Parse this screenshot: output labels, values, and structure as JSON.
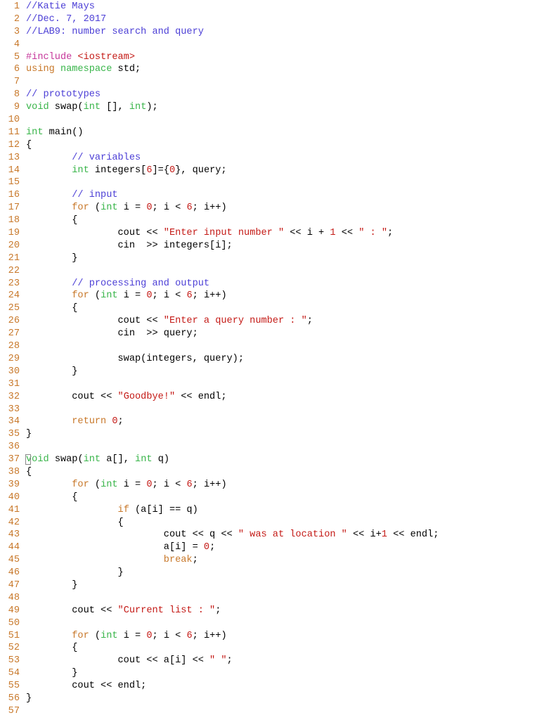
{
  "editor": {
    "colors": {
      "line_number": "#c8782a",
      "comment": "#4c3fd6",
      "preprocessor": "#c6389b",
      "include_path": "#c41a16",
      "keyword": "#c8782a",
      "type": "#39b54a",
      "number": "#c41a16",
      "string": "#c41a16",
      "plain": "#000000"
    },
    "cursor": {
      "line": 37,
      "column": 1
    },
    "lines": [
      {
        "n": "1",
        "tokens": [
          [
            "comment",
            "//Katie Mays"
          ]
        ]
      },
      {
        "n": "2",
        "tokens": [
          [
            "comment",
            "//Dec. 7, 2017"
          ]
        ]
      },
      {
        "n": "3",
        "tokens": [
          [
            "comment",
            "//LAB9: number search and query"
          ]
        ]
      },
      {
        "n": "4",
        "tokens": []
      },
      {
        "n": "5",
        "tokens": [
          [
            "preproc",
            "#include "
          ],
          [
            "include",
            "<iostream>"
          ]
        ]
      },
      {
        "n": "6",
        "tokens": [
          [
            "keyword",
            "using "
          ],
          [
            "type",
            "namespace "
          ],
          [
            "plain",
            "std;"
          ]
        ]
      },
      {
        "n": "7",
        "tokens": []
      },
      {
        "n": "8",
        "tokens": [
          [
            "comment",
            "// prototypes"
          ]
        ]
      },
      {
        "n": "9",
        "tokens": [
          [
            "type",
            "void "
          ],
          [
            "plain",
            "swap("
          ],
          [
            "type",
            "int "
          ],
          [
            "plain",
            "[], "
          ],
          [
            "type",
            "int"
          ],
          [
            "plain",
            ");"
          ]
        ]
      },
      {
        "n": "10",
        "tokens": []
      },
      {
        "n": "11",
        "tokens": [
          [
            "type",
            "int "
          ],
          [
            "plain",
            "main()"
          ]
        ]
      },
      {
        "n": "12",
        "tokens": [
          [
            "plain",
            "{"
          ]
        ]
      },
      {
        "n": "13",
        "tokens": [
          [
            "plain",
            "        "
          ],
          [
            "comment",
            "// variables"
          ]
        ]
      },
      {
        "n": "14",
        "tokens": [
          [
            "plain",
            "        "
          ],
          [
            "type",
            "int "
          ],
          [
            "plain",
            "integers["
          ],
          [
            "number",
            "6"
          ],
          [
            "plain",
            "]={"
          ],
          [
            "number",
            "0"
          ],
          [
            "plain",
            "}, query;"
          ]
        ]
      },
      {
        "n": "15",
        "tokens": []
      },
      {
        "n": "16",
        "tokens": [
          [
            "plain",
            "        "
          ],
          [
            "comment",
            "// input"
          ]
        ]
      },
      {
        "n": "17",
        "tokens": [
          [
            "plain",
            "        "
          ],
          [
            "keyword",
            "for "
          ],
          [
            "plain",
            "("
          ],
          [
            "type",
            "int "
          ],
          [
            "plain",
            "i = "
          ],
          [
            "number",
            "0"
          ],
          [
            "plain",
            "; i < "
          ],
          [
            "number",
            "6"
          ],
          [
            "plain",
            "; i++)"
          ]
        ]
      },
      {
        "n": "18",
        "tokens": [
          [
            "plain",
            "        {"
          ]
        ]
      },
      {
        "n": "19",
        "tokens": [
          [
            "plain",
            "                cout << "
          ],
          [
            "string",
            "\"Enter input number \""
          ],
          [
            "plain",
            " << i + "
          ],
          [
            "number",
            "1"
          ],
          [
            "plain",
            " << "
          ],
          [
            "string",
            "\" : \""
          ],
          [
            "plain",
            ";"
          ]
        ]
      },
      {
        "n": "20",
        "tokens": [
          [
            "plain",
            "                cin  >> integers[i];"
          ]
        ]
      },
      {
        "n": "21",
        "tokens": [
          [
            "plain",
            "        }"
          ]
        ]
      },
      {
        "n": "22",
        "tokens": []
      },
      {
        "n": "23",
        "tokens": [
          [
            "plain",
            "        "
          ],
          [
            "comment",
            "// processing and output"
          ]
        ]
      },
      {
        "n": "24",
        "tokens": [
          [
            "plain",
            "        "
          ],
          [
            "keyword",
            "for "
          ],
          [
            "plain",
            "("
          ],
          [
            "type",
            "int "
          ],
          [
            "plain",
            "i = "
          ],
          [
            "number",
            "0"
          ],
          [
            "plain",
            "; i < "
          ],
          [
            "number",
            "6"
          ],
          [
            "plain",
            "; i++)"
          ]
        ]
      },
      {
        "n": "25",
        "tokens": [
          [
            "plain",
            "        {"
          ]
        ]
      },
      {
        "n": "26",
        "tokens": [
          [
            "plain",
            "                cout << "
          ],
          [
            "string",
            "\"Enter a query number : \""
          ],
          [
            "plain",
            ";"
          ]
        ]
      },
      {
        "n": "27",
        "tokens": [
          [
            "plain",
            "                cin  >> query;"
          ]
        ]
      },
      {
        "n": "28",
        "tokens": []
      },
      {
        "n": "29",
        "tokens": [
          [
            "plain",
            "                swap(integers, query);"
          ]
        ]
      },
      {
        "n": "30",
        "tokens": [
          [
            "plain",
            "        }"
          ]
        ]
      },
      {
        "n": "31",
        "tokens": []
      },
      {
        "n": "32",
        "tokens": [
          [
            "plain",
            "        cout << "
          ],
          [
            "string",
            "\"Goodbye!\""
          ],
          [
            "plain",
            " << endl;"
          ]
        ]
      },
      {
        "n": "33",
        "tokens": []
      },
      {
        "n": "34",
        "tokens": [
          [
            "plain",
            "        "
          ],
          [
            "keyword",
            "return "
          ],
          [
            "number",
            "0"
          ],
          [
            "plain",
            ";"
          ]
        ]
      },
      {
        "n": "35",
        "tokens": [
          [
            "plain",
            "}"
          ]
        ]
      },
      {
        "n": "36",
        "tokens": []
      },
      {
        "n": "37",
        "tokens": [
          [
            "cursor",
            "v"
          ],
          [
            "type",
            "oid "
          ],
          [
            "plain",
            "swap("
          ],
          [
            "type",
            "int "
          ],
          [
            "plain",
            "a[], "
          ],
          [
            "type",
            "int "
          ],
          [
            "plain",
            "q)"
          ]
        ]
      },
      {
        "n": "38",
        "tokens": [
          [
            "plain",
            "{"
          ]
        ]
      },
      {
        "n": "39",
        "tokens": [
          [
            "plain",
            "        "
          ],
          [
            "keyword",
            "for "
          ],
          [
            "plain",
            "("
          ],
          [
            "type",
            "int "
          ],
          [
            "plain",
            "i = "
          ],
          [
            "number",
            "0"
          ],
          [
            "plain",
            "; i < "
          ],
          [
            "number",
            "6"
          ],
          [
            "plain",
            "; i++)"
          ]
        ]
      },
      {
        "n": "40",
        "tokens": [
          [
            "plain",
            "        {"
          ]
        ]
      },
      {
        "n": "41",
        "tokens": [
          [
            "plain",
            "                "
          ],
          [
            "keyword",
            "if "
          ],
          [
            "plain",
            "(a[i] == q)"
          ]
        ]
      },
      {
        "n": "42",
        "tokens": [
          [
            "plain",
            "                {"
          ]
        ]
      },
      {
        "n": "43",
        "tokens": [
          [
            "plain",
            "                        cout << q << "
          ],
          [
            "string",
            "\" was at location \""
          ],
          [
            "plain",
            " << i+"
          ],
          [
            "number",
            "1"
          ],
          [
            "plain",
            " << endl;"
          ]
        ]
      },
      {
        "n": "44",
        "tokens": [
          [
            "plain",
            "                        a[i] = "
          ],
          [
            "number",
            "0"
          ],
          [
            "plain",
            ";"
          ]
        ]
      },
      {
        "n": "45",
        "tokens": [
          [
            "plain",
            "                        "
          ],
          [
            "keyword",
            "break"
          ],
          [
            "plain",
            ";"
          ]
        ]
      },
      {
        "n": "46",
        "tokens": [
          [
            "plain",
            "                }"
          ]
        ]
      },
      {
        "n": "47",
        "tokens": [
          [
            "plain",
            "        }"
          ]
        ]
      },
      {
        "n": "48",
        "tokens": []
      },
      {
        "n": "49",
        "tokens": [
          [
            "plain",
            "        cout << "
          ],
          [
            "string",
            "\"Current list : \""
          ],
          [
            "plain",
            ";"
          ]
        ]
      },
      {
        "n": "50",
        "tokens": []
      },
      {
        "n": "51",
        "tokens": [
          [
            "plain",
            "        "
          ],
          [
            "keyword",
            "for "
          ],
          [
            "plain",
            "("
          ],
          [
            "type",
            "int "
          ],
          [
            "plain",
            "i = "
          ],
          [
            "number",
            "0"
          ],
          [
            "plain",
            "; i < "
          ],
          [
            "number",
            "6"
          ],
          [
            "plain",
            "; i++)"
          ]
        ]
      },
      {
        "n": "52",
        "tokens": [
          [
            "plain",
            "        {"
          ]
        ]
      },
      {
        "n": "53",
        "tokens": [
          [
            "plain",
            "                cout << a[i] << "
          ],
          [
            "string",
            "\" \""
          ],
          [
            "plain",
            ";"
          ]
        ]
      },
      {
        "n": "54",
        "tokens": [
          [
            "plain",
            "        }"
          ]
        ]
      },
      {
        "n": "55",
        "tokens": [
          [
            "plain",
            "        cout << endl;"
          ]
        ]
      },
      {
        "n": "56",
        "tokens": [
          [
            "plain",
            "}"
          ]
        ]
      },
      {
        "n": "57",
        "tokens": []
      }
    ]
  }
}
